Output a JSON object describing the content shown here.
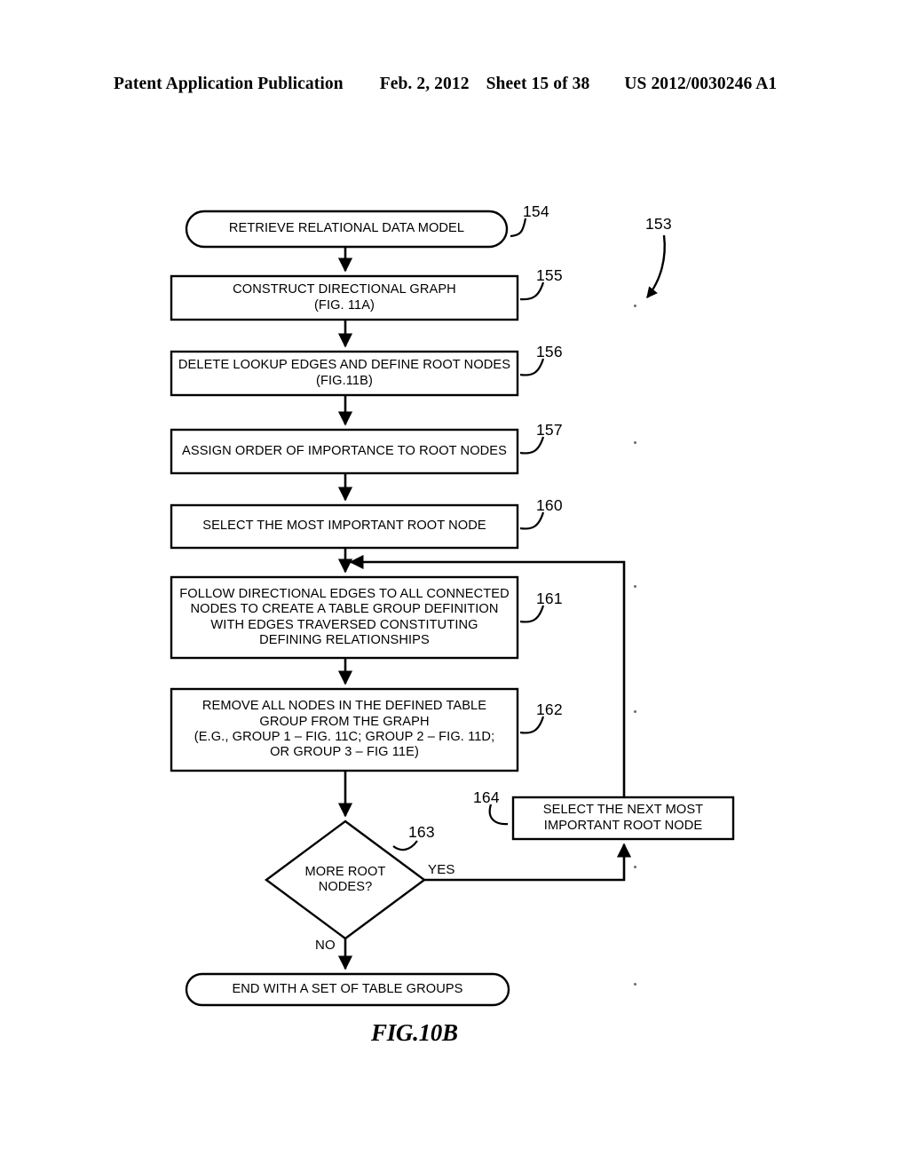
{
  "header": {
    "publication": "Patent Application Publication",
    "date": "Feb. 2, 2012",
    "sheet": "Sheet 15 of 38",
    "patent_number": "US 2012/0030246 A1"
  },
  "figure": {
    "caption": "FIG.10B",
    "diagram_ref": "153"
  },
  "nodes": [
    {
      "id": "start",
      "shape": "terminator",
      "ref": "154",
      "lines": [
        "RETRIEVE RELATIONAL DATA MODEL"
      ]
    },
    {
      "id": "construct-graph",
      "shape": "process",
      "ref": "155",
      "lines": [
        "CONSTRUCT DIRECTIONAL GRAPH",
        "(FIG. 11A)"
      ]
    },
    {
      "id": "delete-lookup-edges",
      "shape": "process",
      "ref": "156",
      "lines": [
        "DELETE LOOKUP EDGES AND DEFINE ROOT NODES",
        "(FIG.11B)"
      ]
    },
    {
      "id": "assign-order",
      "shape": "process",
      "ref": "157",
      "lines": [
        "ASSIGN ORDER OF IMPORTANCE TO ROOT NODES"
      ]
    },
    {
      "id": "select-most-important",
      "shape": "process",
      "ref": "160",
      "lines": [
        "SELECT THE MOST IMPORTANT ROOT NODE"
      ]
    },
    {
      "id": "follow-edges",
      "shape": "process",
      "ref": "161",
      "lines": [
        "FOLLOW DIRECTIONAL EDGES TO ALL CONNECTED",
        "NODES TO CREATE A TABLE GROUP DEFINITION",
        "WITH EDGES TRAVERSED CONSTITUTING",
        "DEFINING RELATIONSHIPS"
      ]
    },
    {
      "id": "remove-nodes",
      "shape": "process",
      "ref": "162",
      "lines": [
        "REMOVE ALL NODES IN THE DEFINED TABLE",
        "GROUP FROM THE GRAPH",
        "(E.G., GROUP 1 – FIG. 11C; GROUP 2 – FIG. 11D;",
        "OR GROUP 3 – FIG 11E)"
      ]
    },
    {
      "id": "more-root-nodes",
      "shape": "decision",
      "ref": "163",
      "lines": [
        "MORE ROOT",
        "NODES?"
      ]
    },
    {
      "id": "select-next-most-important",
      "shape": "process",
      "ref": "164",
      "lines": [
        "SELECT THE NEXT MOST",
        "IMPORTANT ROOT NODE"
      ]
    },
    {
      "id": "end",
      "shape": "terminator",
      "ref": "",
      "lines": [
        "END WITH A SET OF TABLE GROUPS"
      ]
    }
  ],
  "branch_labels": {
    "yes": "YES",
    "no": "NO"
  },
  "colors": {
    "ink": "#000000",
    "paper": "#ffffff"
  }
}
